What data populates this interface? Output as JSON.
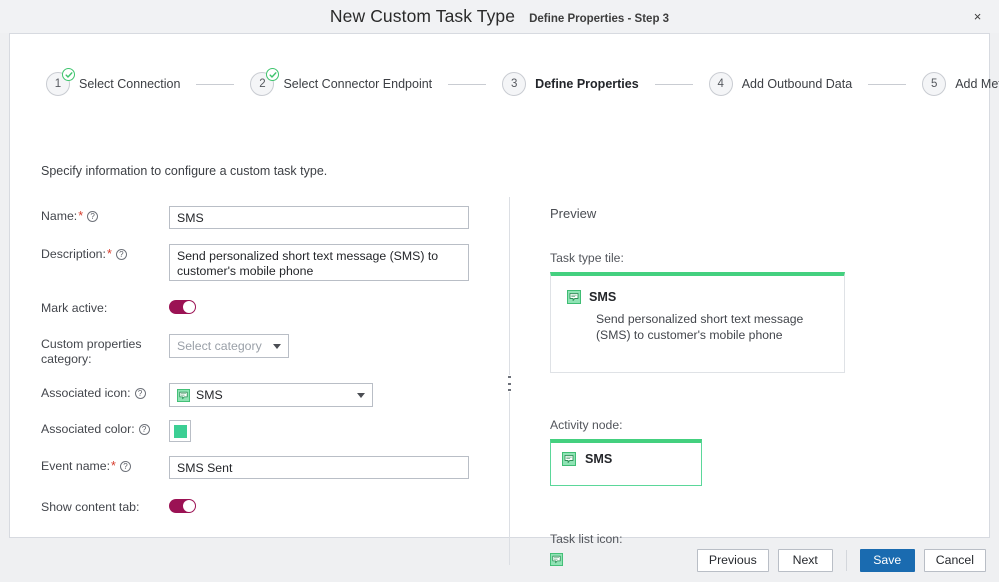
{
  "window": {
    "title": "New Custom Task Type",
    "subtitle": "Define Properties - Step 3",
    "close_label": "×"
  },
  "stepper": {
    "steps": [
      {
        "number": "1",
        "label": "Select Connection",
        "state": "complete"
      },
      {
        "number": "2",
        "label": "Select Connector Endpoint",
        "state": "complete"
      },
      {
        "number": "3",
        "label": "Define Properties",
        "state": "active"
      },
      {
        "number": "4",
        "label": "Add Outbound Data",
        "state": "upcoming"
      },
      {
        "number": "5",
        "label": "Add Metrics",
        "state": "upcoming"
      }
    ]
  },
  "intro": "Specify information to configure a custom task type.",
  "form": {
    "name": {
      "label": "Name:",
      "required": "*",
      "value": "SMS"
    },
    "description": {
      "label": "Description:",
      "required": "*",
      "value": "Send personalized short text message (SMS) to customer's mobile phone"
    },
    "mark_active": {
      "label": "Mark active:",
      "state": "on"
    },
    "custom_properties_category": {
      "label": "Custom properties category:",
      "placeholder": "Select category",
      "value": ""
    },
    "associated_icon": {
      "label": "Associated icon:",
      "value": "SMS",
      "icon": "sms-speech-bubble-icon"
    },
    "associated_color": {
      "label": "Associated color:",
      "value": "#3ccf94"
    },
    "event_name": {
      "label": "Event name:",
      "required": "*",
      "value": "SMS Sent"
    },
    "show_content_tab": {
      "label": "Show content tab:",
      "state": "on"
    }
  },
  "preview": {
    "title": "Preview",
    "task_tile": {
      "label": "Task type tile:",
      "name": "SMS",
      "description": "Send personalized short text message (SMS) to customer's mobile phone",
      "accent_color": "#44d07f"
    },
    "activity_node": {
      "label": "Activity node:",
      "name": "SMS",
      "accent_color": "#44d07f"
    },
    "task_list_icon": {
      "label": "Task list icon:",
      "icon": "sms-speech-bubble-icon"
    }
  },
  "footer": {
    "previous": "Previous",
    "next": "Next",
    "save": "Save",
    "cancel": "Cancel"
  }
}
